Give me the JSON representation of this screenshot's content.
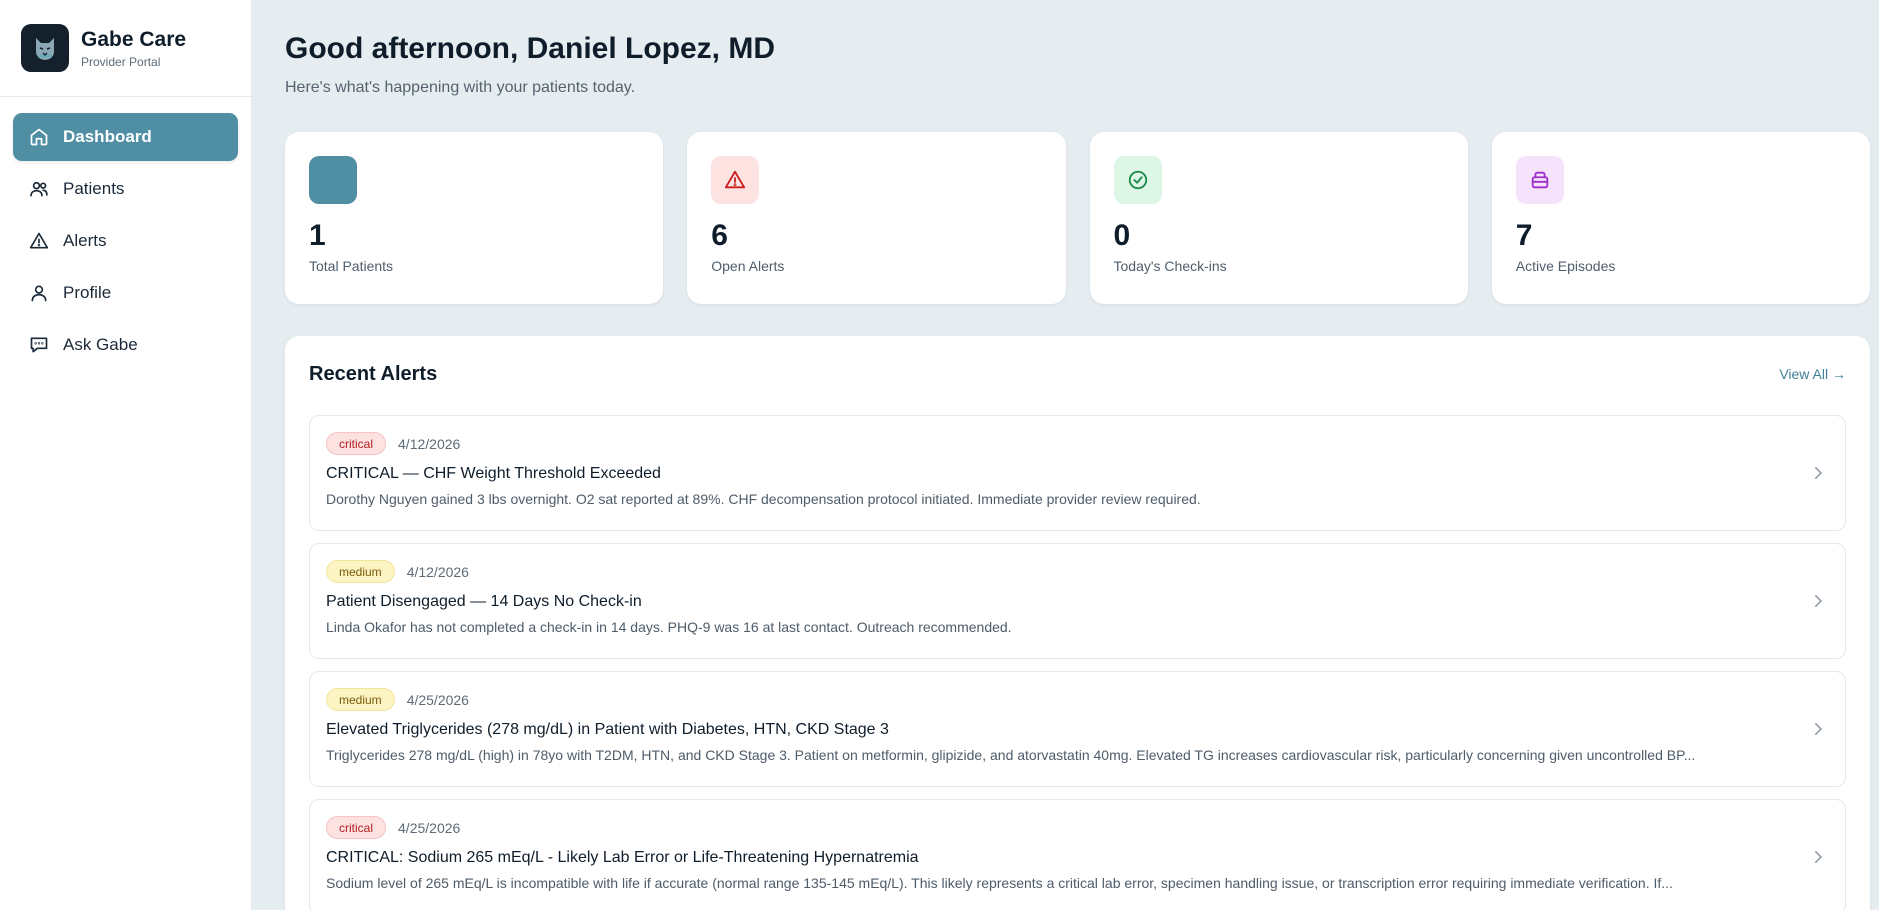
{
  "brand": {
    "title": "Gabe Care",
    "subtitle": "Provider Portal"
  },
  "nav": {
    "items": [
      {
        "label": "Dashboard",
        "icon": "home-icon",
        "active": true
      },
      {
        "label": "Patients",
        "icon": "users-icon",
        "active": false
      },
      {
        "label": "Alerts",
        "icon": "alert-triangle-icon",
        "active": false
      },
      {
        "label": "Profile",
        "icon": "user-icon",
        "active": false
      },
      {
        "label": "Ask Gabe",
        "icon": "message-icon",
        "active": false
      }
    ]
  },
  "header": {
    "greeting": "Good afternoon, Daniel Lopez, MD",
    "subtitle": "Here's what's happening with your patients today."
  },
  "stats": [
    {
      "value": "1",
      "label": "Total Patients",
      "icon": "blank-icon",
      "color": "#4f8ea3"
    },
    {
      "value": "6",
      "label": "Open Alerts",
      "icon": "alert-triangle-icon",
      "color": "#fde2e2"
    },
    {
      "value": "0",
      "label": "Today's Check-ins",
      "icon": "check-circle-icon",
      "color": "#ddf6e6"
    },
    {
      "value": "7",
      "label": "Active Episodes",
      "icon": "container-icon",
      "color": "#f4e3fb"
    }
  ],
  "alerts": {
    "title": "Recent Alerts",
    "view_all": "View All →",
    "items": [
      {
        "severity": "critical",
        "date": "4/12/2026",
        "title": "CRITICAL — CHF Weight Threshold Exceeded",
        "description": "Dorothy Nguyen gained 3 lbs overnight. O2 sat reported at 89%. CHF decompensation protocol initiated. Immediate provider review required."
      },
      {
        "severity": "medium",
        "date": "4/12/2026",
        "title": "Patient Disengaged — 14 Days No Check-in",
        "description": "Linda Okafor has not completed a check-in in 14 days. PHQ-9 was 16 at last contact. Outreach recommended."
      },
      {
        "severity": "medium",
        "date": "4/25/2026",
        "title": "Elevated Triglycerides (278 mg/dL) in Patient with Diabetes, HTN, CKD Stage 3",
        "description": "Triglycerides 278 mg/dL (high) in 78yo with T2DM, HTN, and CKD Stage 3. Patient on metformin, glipizide, and atorvastatin 40mg. Elevated TG increases cardiovascular risk, particularly concerning given uncontrolled BP..."
      },
      {
        "severity": "critical",
        "date": "4/25/2026",
        "title": "CRITICAL: Sodium 265 mEq/L - Likely Lab Error or Life-Threatening Hypernatremia",
        "description": "Sodium level of 265 mEq/L is incompatible with life if accurate (normal range 135-145 mEq/L). This likely represents a critical lab error, specimen handling issue, or transcription error requiring immediate verification. If..."
      }
    ]
  }
}
